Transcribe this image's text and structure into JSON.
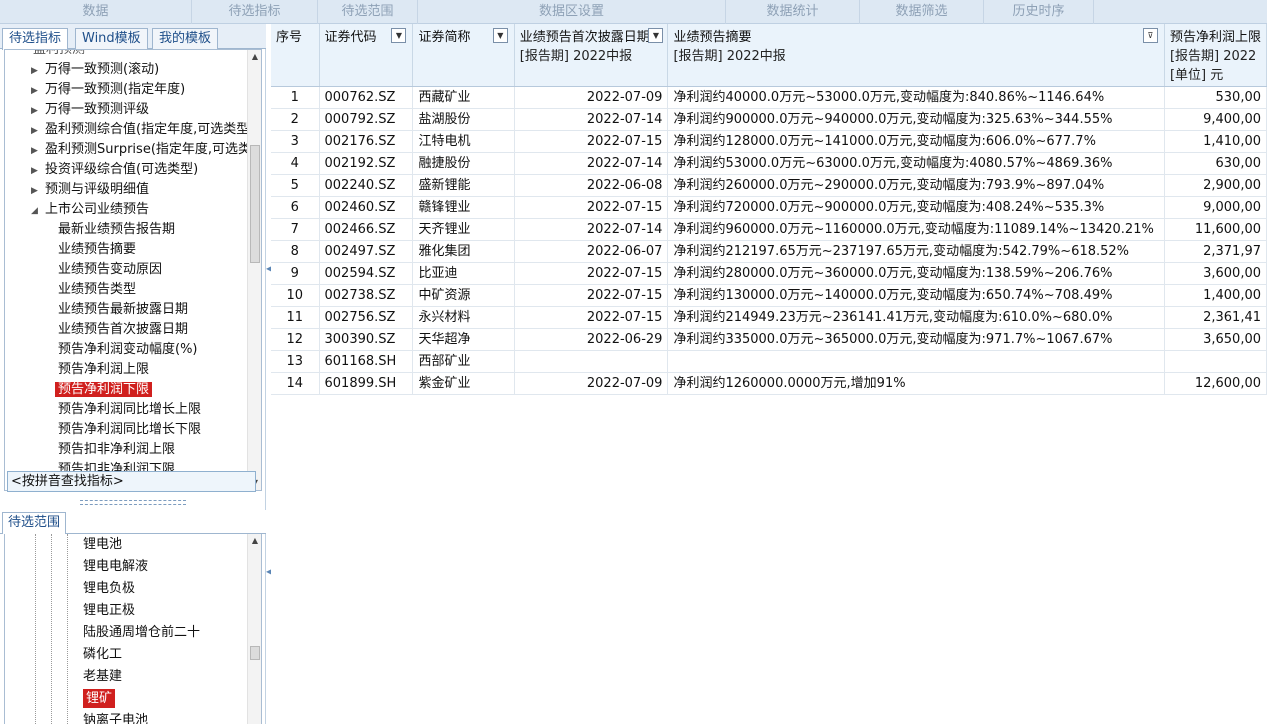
{
  "toolbar": {
    "sections": [
      "数据",
      "待选指标",
      "待选范围",
      "数据区设置",
      "数据统计",
      "数据筛选",
      "历史时序"
    ]
  },
  "left_panel": {
    "tabs": [
      "待选指标",
      "Wind模板",
      "我的模板"
    ],
    "tree_partial_top": "盈利预测",
    "tree_items": [
      {
        "label": "万得一致预测(滚动)",
        "collapsed": true
      },
      {
        "label": "万得一致预测(指定年度)",
        "collapsed": true
      },
      {
        "label": "万得一致预测评级",
        "collapsed": true
      },
      {
        "label": "盈利预测综合值(指定年度,可选类型",
        "collapsed": true
      },
      {
        "label": "盈利预测Surprise(指定年度,可选类",
        "collapsed": true
      },
      {
        "label": "投资评级综合值(可选类型)",
        "collapsed": true
      },
      {
        "label": "预测与评级明细值",
        "collapsed": true
      },
      {
        "label": "上市公司业绩预告",
        "collapsed": false
      }
    ],
    "sub_items": [
      "最新业绩预告报告期",
      "业绩预告摘要",
      "业绩预告变动原因",
      "业绩预告类型",
      "业绩预告最新披露日期",
      "业绩预告首次披露日期",
      "预告净利润变动幅度(%)",
      "预告净利润上限",
      "预告净利润下限",
      "预告净利润同比增长上限",
      "预告净利润同比增长下限",
      "预告扣非净利润上限",
      "预告扣非净利润下限"
    ],
    "selected_sub_item": "预告净利润下限",
    "pinyin_search_placeholder": "<按拼音查找指标>",
    "range_tab": "待选范围",
    "range_items": [
      "锂电池",
      "锂电电解液",
      "锂电负极",
      "锂电正极",
      "陆股通周增仓前二十",
      "磷化工",
      "老基建",
      "锂矿",
      "钠离子电池"
    ],
    "selected_range_item": "锂矿"
  },
  "table": {
    "headers": {
      "seq": "序号",
      "code": "证券代码",
      "name": "证券简称",
      "first_date": "业绩预告首次披露日期",
      "first_date_sub": "[报告期] 2022中报",
      "summary": "业绩预告摘要",
      "summary_sub": "[报告期] 2022中报",
      "upper": "预告净利润上限",
      "upper_sub": "[报告期] 2022",
      "upper_unit": "[单位] 元"
    },
    "rows": [
      {
        "seq": "1",
        "code": "000762.SZ",
        "name": "西藏矿业",
        "date": "2022-07-09",
        "summary": "净利润约40000.0万元~53000.0万元,变动幅度为:840.86%~1146.64%",
        "upper": "530,00"
      },
      {
        "seq": "2",
        "code": "000792.SZ",
        "name": "盐湖股份",
        "date": "2022-07-14",
        "summary": "净利润约900000.0万元~940000.0万元,变动幅度为:325.63%~344.55%",
        "upper": "9,400,00"
      },
      {
        "seq": "3",
        "code": "002176.SZ",
        "name": "江特电机",
        "date": "2022-07-15",
        "summary": "净利润约128000.0万元~141000.0万元,变动幅度为:606.0%~677.7%",
        "upper": "1,410,00"
      },
      {
        "seq": "4",
        "code": "002192.SZ",
        "name": "融捷股份",
        "date": "2022-07-14",
        "summary": "净利润约53000.0万元~63000.0万元,变动幅度为:4080.57%~4869.36%",
        "upper": "630,00"
      },
      {
        "seq": "5",
        "code": "002240.SZ",
        "name": "盛新锂能",
        "date": "2022-06-08",
        "summary": "净利润约260000.0万元~290000.0万元,变动幅度为:793.9%~897.04%",
        "upper": "2,900,00"
      },
      {
        "seq": "6",
        "code": "002460.SZ",
        "name": "赣锋锂业",
        "date": "2022-07-15",
        "summary": "净利润约720000.0万元~900000.0万元,变动幅度为:408.24%~535.3%",
        "upper": "9,000,00"
      },
      {
        "seq": "7",
        "code": "002466.SZ",
        "name": "天齐锂业",
        "date": "2022-07-14",
        "summary": "净利润约960000.0万元~1160000.0万元,变动幅度为:11089.14%~13420.21%",
        "upper": "11,600,00"
      },
      {
        "seq": "8",
        "code": "002497.SZ",
        "name": "雅化集团",
        "date": "2022-06-07",
        "summary": "净利润约212197.65万元~237197.65万元,变动幅度为:542.79%~618.52%",
        "upper": "2,371,97"
      },
      {
        "seq": "9",
        "code": "002594.SZ",
        "name": "比亚迪",
        "date": "2022-07-15",
        "summary": "净利润约280000.0万元~360000.0万元,变动幅度为:138.59%~206.76%",
        "upper": "3,600,00"
      },
      {
        "seq": "10",
        "code": "002738.SZ",
        "name": "中矿资源",
        "date": "2022-07-15",
        "summary": "净利润约130000.0万元~140000.0万元,变动幅度为:650.74%~708.49%",
        "upper": "1,400,00"
      },
      {
        "seq": "11",
        "code": "002756.SZ",
        "name": "永兴材料",
        "date": "2022-07-15",
        "summary": "净利润约214949.23万元~236141.41万元,变动幅度为:610.0%~680.0%",
        "upper": "2,361,41"
      },
      {
        "seq": "12",
        "code": "300390.SZ",
        "name": "天华超净",
        "date": "2022-06-29",
        "summary": "净利润约335000.0万元~365000.0万元,变动幅度为:971.7%~1067.67%",
        "upper": "3,650,00"
      },
      {
        "seq": "13",
        "code": "601168.SH",
        "name": "西部矿业",
        "date": "",
        "summary": "",
        "upper": ""
      },
      {
        "seq": "14",
        "code": "601899.SH",
        "name": "紫金矿业",
        "date": "2022-07-09",
        "summary": "净利润约1260000.0000万元,增加91%",
        "upper": "12,600,00"
      }
    ]
  }
}
